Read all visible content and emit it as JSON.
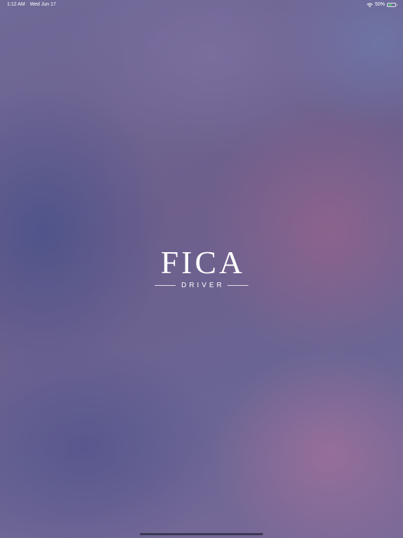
{
  "status_bar": {
    "time": "1:12 AM",
    "date": "Wed Jun 17",
    "battery_percent_label": "50%",
    "battery_level": 0.5,
    "wifi_icon": "wifi-icon",
    "battery_icon": "battery-icon",
    "charging_color": "#4cd964"
  },
  "splash": {
    "title": "FICA",
    "subtitle": "DRIVER"
  }
}
